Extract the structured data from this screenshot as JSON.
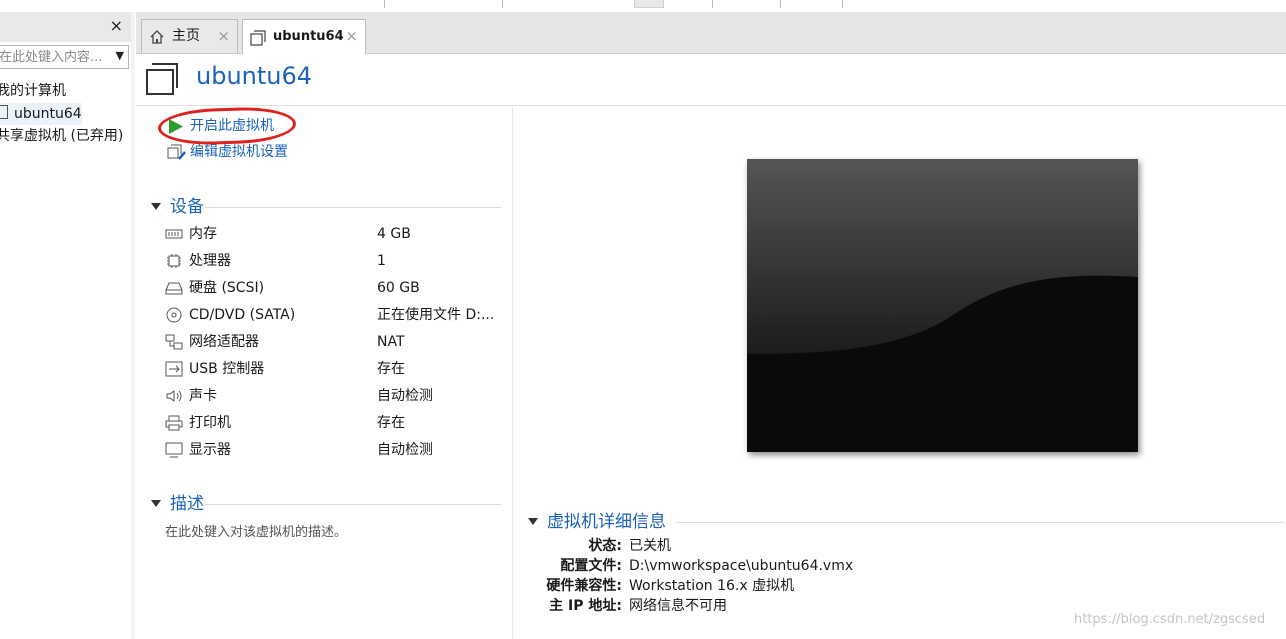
{
  "sidebar": {
    "close": "×",
    "search_placeholder": "在此处键入内容...",
    "items": [
      {
        "label": "我的计算机"
      },
      {
        "label": "ubuntu64"
      },
      {
        "label": "共享虚拟机 (已弃用)"
      }
    ]
  },
  "tabs": [
    {
      "label": "主页",
      "icon": "home-icon"
    },
    {
      "label": "ubuntu64",
      "icon": "vm-icon"
    }
  ],
  "tab_close": "×",
  "vm": {
    "title": "ubuntu64",
    "actions": {
      "power_on": "开启此虚拟机",
      "edit_settings": "编辑虚拟机设置"
    },
    "devices": {
      "header": "设备",
      "items": [
        {
          "name": "内存",
          "value": "4 GB",
          "icon": "memory-icon"
        },
        {
          "name": "处理器",
          "value": "1",
          "icon": "cpu-icon"
        },
        {
          "name": "硬盘 (SCSI)",
          "value": "60 GB",
          "icon": "harddisk-icon"
        },
        {
          "name": "CD/DVD (SATA)",
          "value": "正在使用文件 D:...",
          "icon": "cdrom-icon"
        },
        {
          "name": "网络适配器",
          "value": "NAT",
          "icon": "network-icon"
        },
        {
          "name": "USB 控制器",
          "value": "存在",
          "icon": "usb-icon"
        },
        {
          "name": "声卡",
          "value": "自动检测",
          "icon": "sound-icon"
        },
        {
          "name": "打印机",
          "value": "存在",
          "icon": "printer-icon"
        },
        {
          "name": "显示器",
          "value": "自动检测",
          "icon": "display-icon"
        }
      ]
    },
    "description": {
      "header": "描述",
      "placeholder": "在此处键入对该虚拟机的描述。"
    },
    "details": {
      "header": "虚拟机详细信息",
      "rows": [
        {
          "label": "状态:",
          "value": "已关机"
        },
        {
          "label": "配置文件:",
          "value": "D:\\vmworkspace\\ubuntu64.vmx"
        },
        {
          "label": "硬件兼容性:",
          "value": "Workstation 16.x 虚拟机"
        },
        {
          "label": "主 IP 地址:",
          "value": "网络信息不可用"
        }
      ]
    }
  },
  "watermark": "https://blog.csdn.net/zgscsed",
  "colors": {
    "accent": "#1b63b8",
    "annotation": "#e0201b",
    "play": "#2e9b2e"
  }
}
